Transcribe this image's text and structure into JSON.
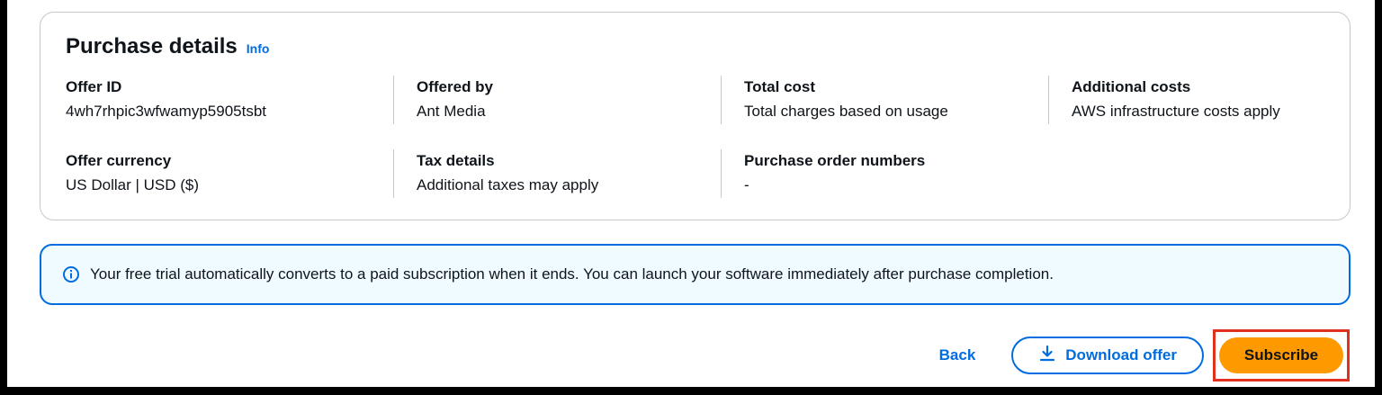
{
  "purchase_details": {
    "title": "Purchase details",
    "info_label": "Info",
    "fields": [
      {
        "label": "Offer ID",
        "value": "4wh7rhpic3wfwamyp5905tsbt"
      },
      {
        "label": "Offered by",
        "value": "Ant Media"
      },
      {
        "label": "Total cost",
        "value": "Total charges based on usage"
      },
      {
        "label": "Additional costs",
        "value": "AWS infrastructure costs apply"
      },
      {
        "label": "Offer currency",
        "value": "US Dollar | USD ($)"
      },
      {
        "label": "Tax details",
        "value": "Additional taxes may apply"
      },
      {
        "label": "Purchase order numbers",
        "value": "-"
      }
    ]
  },
  "alert": {
    "icon": "info-circle-icon",
    "text": "Your free trial automatically converts to a paid subscription when it ends. You can launch your software immediately after purchase completion."
  },
  "actions": {
    "back_label": "Back",
    "download_label": "Download offer",
    "download_icon": "download-icon",
    "subscribe_label": "Subscribe"
  },
  "colors": {
    "link": "#006ce0",
    "primary_button": "#ff9900",
    "alert_background": "#f0fbff",
    "highlight_border": "#e0301e"
  }
}
